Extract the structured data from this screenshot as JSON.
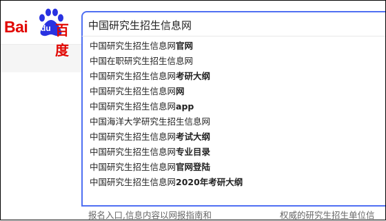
{
  "logo": {
    "latin": "Bai",
    "du": "du",
    "chinese": "百度"
  },
  "search": {
    "query": "中国研究生招生信息网"
  },
  "suggestions": [
    {
      "prefix": "中国研究生招生信息网",
      "bold": "官网"
    },
    {
      "prefix": "中国在职研究生招生信息网",
      "bold": ""
    },
    {
      "prefix": "中国研究生招生信息网",
      "bold": "考研大纲"
    },
    {
      "prefix": "中国研究生招生信息网",
      "bold": "网"
    },
    {
      "prefix": "中国研究生招生信息网",
      "bold": "app"
    },
    {
      "prefix": "中国海洋大学研究生招生信息网",
      "bold": ""
    },
    {
      "prefix": "中国研究生招生信息网",
      "bold": "考试大纲"
    },
    {
      "prefix": "中国研究生招生信息网",
      "bold": "专业目录"
    },
    {
      "prefix": "中国研究生招生信息网",
      "bold": "官网登陆"
    },
    {
      "prefix": "中国研究生招生信息网",
      "bold": "2020年考研大纲"
    }
  ],
  "footer": {
    "left": "报名入口,信息内容以网报指南和",
    "right": "权威的研究生招生单位信"
  },
  "colors": {
    "brand_red": "#e10601",
    "brand_blue": "#2932e1",
    "focus_blue": "#4e6ef2"
  }
}
